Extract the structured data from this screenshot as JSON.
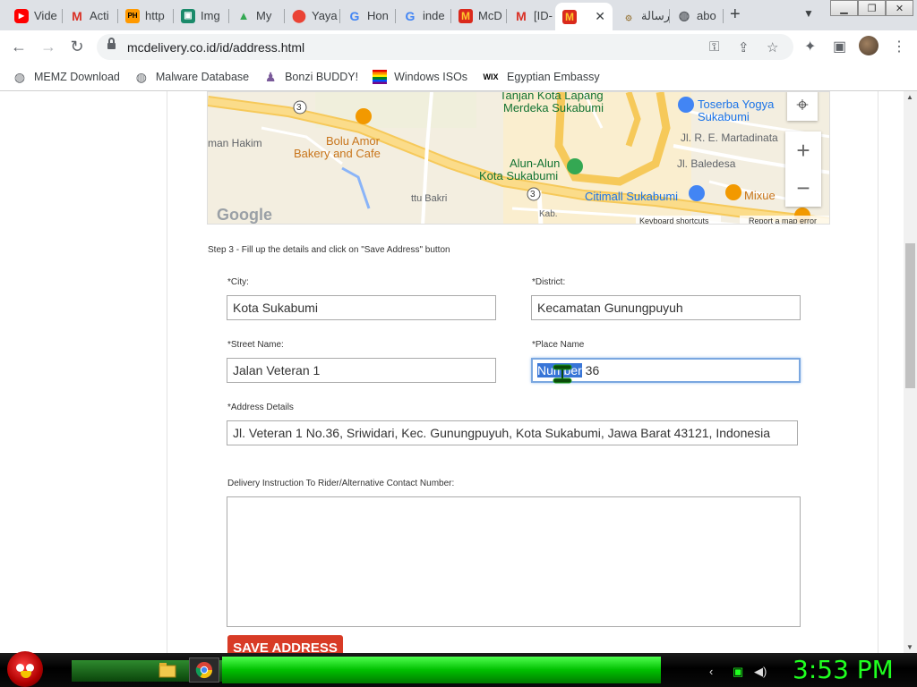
{
  "tabs": [
    {
      "label": "Vide",
      "icon": "youtube-icon"
    },
    {
      "label": "Acti",
      "icon": "gmail-icon"
    },
    {
      "label": "http",
      "icon": "ph-icon"
    },
    {
      "label": "Img",
      "icon": "img-icon"
    },
    {
      "label": "My",
      "icon": "drive-icon"
    },
    {
      "label": "Yaya",
      "icon": "maps-icon"
    },
    {
      "label": "Hon",
      "icon": "google-icon"
    },
    {
      "label": "inde",
      "icon": "google-icon"
    },
    {
      "label": "McD",
      "icon": "mcdonalds-icon"
    },
    {
      "label": "[ID-",
      "icon": "gmail-icon"
    },
    {
      "label": "",
      "icon": "mcdonalds-icon",
      "active": true
    },
    {
      "label": "رسالة",
      "icon": "arabic-site-icon"
    },
    {
      "label": "abo",
      "icon": "globe-icon"
    }
  ],
  "omnibox": {
    "url": "mcdelivery.co.id/id/address.html"
  },
  "bookmarks": [
    {
      "label": "MEMZ Download",
      "icon": "globe-icon"
    },
    {
      "label": "Malware Database",
      "icon": "globe-icon"
    },
    {
      "label": "Bonzi BUDDY!",
      "icon": "bonzi-icon"
    },
    {
      "label": "Windows ISOs",
      "icon": "windows-flag-icon"
    },
    {
      "label": "Egyptian Embassy",
      "icon": "wix-icon"
    }
  ],
  "map": {
    "labels": {
      "tanjan": "Tanjan Kota Lapang",
      "merdeka": "Merdeka Sukabumi",
      "toserba1": "Toserba Yogya",
      "toserba2": "Sukabumi",
      "martadinata": "Jl. R. E. Martadinata",
      "hakim": "man Hakim",
      "bolu1": "Bolu Amor",
      "bolu2": "Bakery and Cafe",
      "baledesa": "Jl. Baledesa",
      "alun1": "Alun-Alun",
      "alun2": "Kota Sukabumi",
      "citimall": "Citimall Sukabumi",
      "mixue": "Mixue",
      "bakri": "ttu Bakri",
      "kab": "Kab.",
      "shortcuts": "Keyboard shortcuts",
      "report": "Report a map error",
      "google": "Google",
      "route3a": "3",
      "route3b": "3"
    }
  },
  "form": {
    "step": "Step 3 - Fill up the details and click on \"Save Address\" button",
    "city_label": "*City:",
    "city_value": "Kota Sukabumi",
    "district_label": "*District:",
    "district_value": "Kecamatan Gunungpuyuh",
    "street_label": "*Street Name:",
    "street_value": "Jalan Veteran 1",
    "place_label": "*Place Name",
    "place_value_selected": "Number",
    "place_value_rest": " 36",
    "address_label": "*Address Details",
    "address_value": "Jl. Veteran 1 No.36, Sriwidari, Kec. Gunungpuyuh, Kota Sukabumi, Jawa Barat 43121, Indonesia",
    "instruction_label": "Delivery Instruction To Rider/Alternative Contact Number:",
    "instruction_value": "",
    "save_label": "SAVE ADDRESS"
  },
  "taskbar": {
    "clock": "3:53 PM"
  },
  "colors": {
    "accent_red": "#d83b26",
    "clock_green": "#20ff20",
    "selection": "#3875d7"
  }
}
